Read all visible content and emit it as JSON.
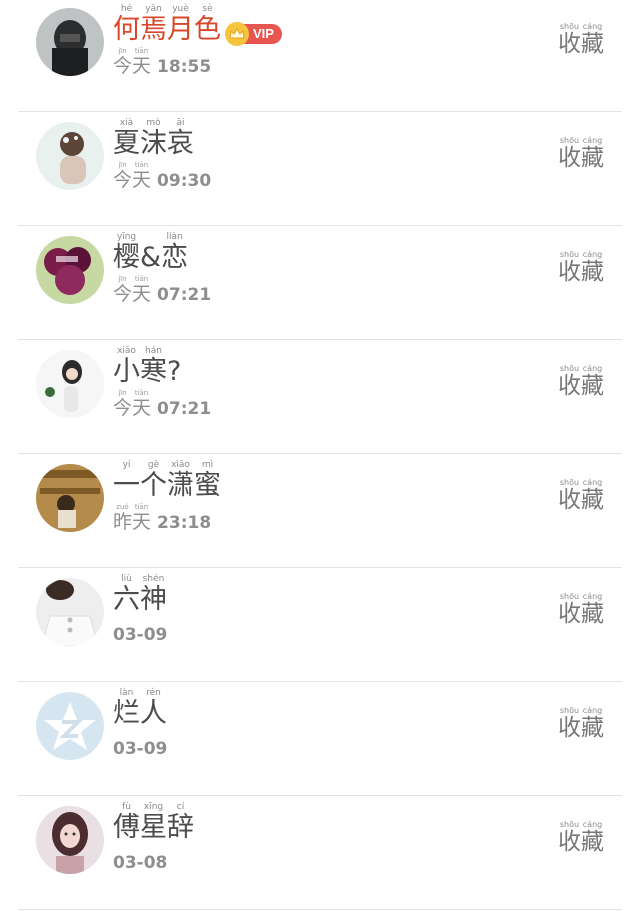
{
  "rows": [
    {
      "name_chars": [
        [
          "何",
          "hé"
        ],
        [
          "焉",
          "yān"
        ],
        [
          "月",
          "yuè"
        ],
        [
          "色",
          "sè"
        ]
      ],
      "vip": true,
      "vip_label": "VIP",
      "day": [
        [
          "今",
          "jīn"
        ],
        [
          "天",
          "tiān"
        ]
      ],
      "time": "18:55",
      "collect": [
        [
          "收",
          "shōu"
        ],
        [
          "藏",
          "cáng"
        ]
      ],
      "avatar": "avatar-dark-figure"
    },
    {
      "name_chars": [
        [
          "夏",
          "xià"
        ],
        [
          "沫",
          "mò"
        ],
        [
          "哀",
          "āi"
        ]
      ],
      "day": [
        [
          "今",
          "jīn"
        ],
        [
          "天",
          "tiān"
        ]
      ],
      "time": "09:30",
      "collect": [
        [
          "收",
          "shōu"
        ],
        [
          "藏",
          "cáng"
        ]
      ],
      "avatar": "avatar-hair-back"
    },
    {
      "name_chars": [
        [
          "樱",
          "yīng"
        ],
        [
          "&",
          ""
        ],
        [
          "恋",
          "liàn"
        ]
      ],
      "day": [
        [
          "今",
          "jīn"
        ],
        [
          "天",
          "tiān"
        ]
      ],
      "time": "07:21",
      "collect": [
        [
          "收",
          "shōu"
        ],
        [
          "藏",
          "cáng"
        ]
      ],
      "avatar": "avatar-flowers"
    },
    {
      "name_chars": [
        [
          "小",
          "xiǎo"
        ],
        [
          "寒",
          "hán"
        ],
        [
          "?",
          ""
        ]
      ],
      "day": [
        [
          "今",
          "jīn"
        ],
        [
          "天",
          "tiān"
        ]
      ],
      "time": "07:21",
      "collect": [
        [
          "收",
          "shōu"
        ],
        [
          "藏",
          "cáng"
        ]
      ],
      "avatar": "avatar-girl-white"
    },
    {
      "name_chars": [
        [
          "一",
          "yí"
        ],
        [
          "个",
          "gè"
        ],
        [
          "潇",
          "xiāo"
        ],
        [
          "蜜",
          "mì"
        ]
      ],
      "day": [
        [
          "昨",
          "zuó"
        ],
        [
          "天",
          "tiān"
        ]
      ],
      "time": "23:18",
      "collect": [
        [
          "收",
          "shōu"
        ],
        [
          "藏",
          "cáng"
        ]
      ],
      "avatar": "avatar-bookshelf"
    },
    {
      "name_chars": [
        [
          "六",
          "liù"
        ],
        [
          "神",
          "shén"
        ]
      ],
      "date": "03-09",
      "collect": [
        [
          "收",
          "shōu"
        ],
        [
          "藏",
          "cáng"
        ]
      ],
      "avatar": "avatar-white-shirt"
    },
    {
      "name_chars": [
        [
          "烂",
          "làn"
        ],
        [
          "人",
          "rén"
        ]
      ],
      "date": "03-09",
      "collect": [
        [
          "收",
          "shōu"
        ],
        [
          "藏",
          "cáng"
        ]
      ],
      "avatar": "avatar-default-qzone"
    },
    {
      "name_chars": [
        [
          "傅",
          "fù"
        ],
        [
          "星",
          "xīng"
        ],
        [
          "辞",
          "cí"
        ]
      ],
      "date": "03-08",
      "collect": [
        [
          "收",
          "shōu"
        ],
        [
          "藏",
          "cáng"
        ]
      ],
      "avatar": "avatar-pink-hair"
    }
  ],
  "colors": {
    "highlight_name": "#d9472b",
    "vip_badge": "#e7564f",
    "vip_crown": "#f6c53d",
    "text_main": "#4c4c4c",
    "text_meta": "#8e8e8e",
    "divider": "#e3e3e3"
  }
}
